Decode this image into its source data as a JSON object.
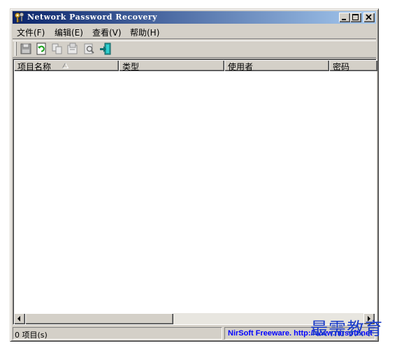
{
  "window": {
    "title": "Network Password Recovery",
    "icon": "keys-icon",
    "controls": [
      "minimize-icon",
      "maximize-icon",
      "close-icon"
    ]
  },
  "menu": {
    "items": [
      {
        "label": "文件(F)"
      },
      {
        "label": "编辑(E)"
      },
      {
        "label": "查看(V)"
      },
      {
        "label": "帮助(H)"
      }
    ]
  },
  "toolbar": {
    "buttons": [
      "save-icon",
      "refresh-icon",
      "copy-icon",
      "properties-icon",
      "find-icon",
      "exit-icon"
    ]
  },
  "list": {
    "columns": [
      {
        "label": "项目名称",
        "sorted": true
      },
      {
        "label": "类型"
      },
      {
        "label": "使用者"
      },
      {
        "label": "密码"
      }
    ],
    "rows": []
  },
  "status": {
    "count": "0 项目(s)",
    "link": "NirSoft Freeware.  http://www.nirsoft.net"
  },
  "watermark": "最需教育",
  "colors": {
    "title_start": "#0a246a",
    "title_end": "#a6caf0",
    "face": "#d4d0c8",
    "link": "#0000ff",
    "watermark": "#1a3cc8"
  }
}
